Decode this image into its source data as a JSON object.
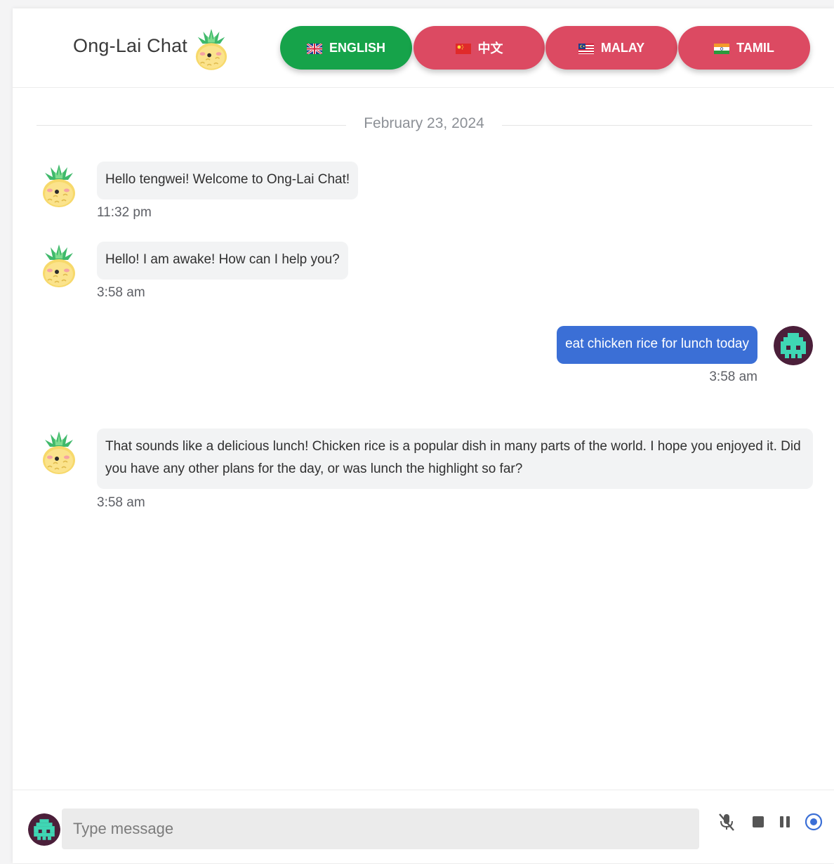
{
  "header": {
    "title": "Ong-Lai Chat",
    "languages": [
      {
        "label": "ENGLISH",
        "active": true,
        "color": "#16a34a"
      },
      {
        "label": "中文",
        "active": false,
        "color": "#dc4a62"
      },
      {
        "label": "MALAY",
        "active": false,
        "color": "#dc4a62"
      },
      {
        "label": "TAMIL",
        "active": false,
        "color": "#dc4a62"
      }
    ]
  },
  "chat": {
    "date": "February 23, 2024",
    "messages": [
      {
        "sender": "bot",
        "text": "Hello tengwei! Welcome to Ong-Lai Chat!",
        "time": "11:32 pm"
      },
      {
        "sender": "bot",
        "text": "Hello! I am awake! How can I help you?",
        "time": "3:58 am"
      },
      {
        "sender": "user",
        "text": "eat chicken rice for lunch today",
        "time": "3:58 am"
      },
      {
        "sender": "bot",
        "text": "That sounds like a delicious lunch! Chicken rice is a popular dish in many parts of the world. I hope you enjoyed it. Did you have any other plans for the day, or was lunch the highlight so far?",
        "time": "3:58 am"
      }
    ]
  },
  "composer": {
    "placeholder": "Type message",
    "value": ""
  },
  "icons": {
    "logo": "pineapple-icon",
    "bot_avatar": "pineapple-icon",
    "user_avatar": "pixel-invader-icon",
    "mic": "mic-off-icon",
    "stop": "stop-icon",
    "pause": "pause-icon",
    "record": "record-icon"
  },
  "colors": {
    "user_bubble": "#3b6fd6",
    "bot_bubble": "#f2f3f4",
    "active_language": "#16a34a",
    "inactive_language": "#dc4a62",
    "record_accent": "#3b6fd6"
  }
}
